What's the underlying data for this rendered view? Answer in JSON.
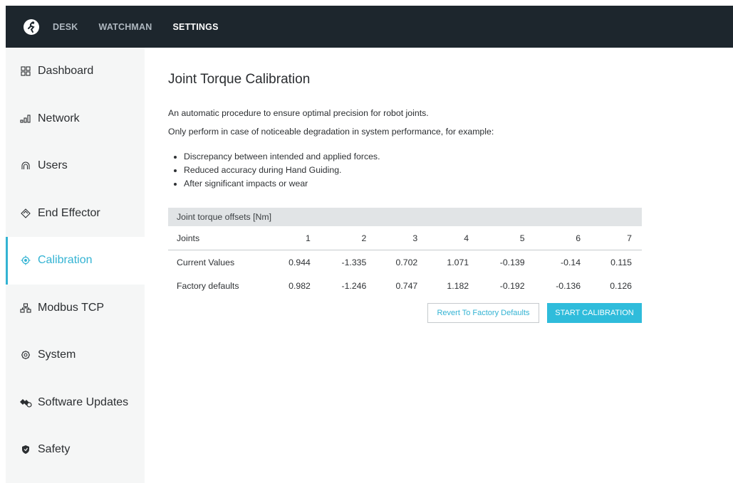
{
  "nav": {
    "items": [
      {
        "label": "DESK",
        "active": false
      },
      {
        "label": "WATCHMAN",
        "active": false
      },
      {
        "label": "SETTINGS",
        "active": true
      }
    ]
  },
  "sidebar": {
    "items": [
      {
        "label": "Dashboard",
        "icon": "dashboard-icon"
      },
      {
        "label": "Network",
        "icon": "network-icon"
      },
      {
        "label": "Users",
        "icon": "users-icon"
      },
      {
        "label": "End Effector",
        "icon": "end-effector-icon"
      },
      {
        "label": "Calibration",
        "icon": "calibration-icon",
        "active": true
      },
      {
        "label": "Modbus TCP",
        "icon": "modbus-icon"
      },
      {
        "label": "System",
        "icon": "gear-icon"
      },
      {
        "label": "Software Updates",
        "icon": "software-updates-icon"
      },
      {
        "label": "Safety",
        "icon": "shield-icon"
      }
    ]
  },
  "main": {
    "title": "Joint Torque Calibration",
    "desc1": "An automatic procedure to ensure optimal precision for robot joints.",
    "desc2": "Only perform in case of noticeable degradation in system performance, for example:",
    "bullets": [
      "Discrepancy between intended and applied forces.",
      "Reduced accuracy during Hand Guiding.",
      "After significant impacts or wear"
    ],
    "offsets": {
      "header": "Joint torque offsets [Nm]",
      "columns": [
        "Joints",
        "1",
        "2",
        "3",
        "4",
        "5",
        "6",
        "7"
      ],
      "rows": [
        {
          "label": "Current Values",
          "values": [
            "0.944",
            "-1.335",
            "0.702",
            "1.071",
            "-0.139",
            "-0.14",
            "0.115"
          ]
        },
        {
          "label": "Factory defaults",
          "values": [
            "0.982",
            "-1.246",
            "0.747",
            "1.182",
            "-0.192",
            "-0.136",
            "0.126"
          ]
        }
      ]
    },
    "revert_label": "Revert To Factory Defaults",
    "start_label": "START CALIBRATION"
  },
  "colors": {
    "accent": "#2fbcdb",
    "topbar": "#1d262d",
    "sidebar": "#f5f6f6"
  }
}
